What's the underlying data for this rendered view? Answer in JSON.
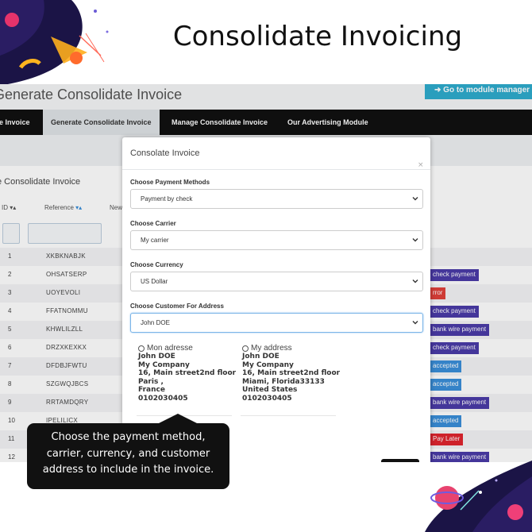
{
  "promo": {
    "title": "Consolidate Invoicing",
    "tooltip": "Choose the payment method, carrier, currency, and customer address to include in the invoice."
  },
  "app": {
    "page_title": "Generate Consolidate Invoice",
    "module_button": "Go to module manager",
    "nav_tabs": [
      {
        "label": "Create Invoice",
        "active": false
      },
      {
        "label": "Generate Consolidate Invoice",
        "active": true
      },
      {
        "label": "Manage Consolidate Invoice",
        "active": false
      },
      {
        "label": "Our Advertising Module",
        "active": false
      }
    ],
    "nav_partial_label": "te Invoice",
    "panel_title": "Generate Consolidate Invoice",
    "panel_partial_title": "e Consolidate Invoice",
    "columns": {
      "id": "ID",
      "reference": "Reference",
      "partial_new": "New"
    },
    "rows": [
      {
        "id": "1",
        "reference": "XKBKNABJK",
        "status": "",
        "status_color": ""
      },
      {
        "id": "2",
        "reference": "OHSATSERP",
        "status": "check payment",
        "status_color": "#4a3ba8"
      },
      {
        "id": "3",
        "reference": "UOYEVOLI",
        "status": "rror",
        "status_color": "#e0403a"
      },
      {
        "id": "4",
        "reference": "FFATNOMMU",
        "status": "check payment",
        "status_color": "#4a3ba8"
      },
      {
        "id": "5",
        "reference": "KHWLILZLL",
        "status": "bank wire payment",
        "status_color": "#4a3ba8"
      },
      {
        "id": "6",
        "reference": "DRZXKEXKX",
        "status": "check payment",
        "status_color": "#4a3ba8"
      },
      {
        "id": "7",
        "reference": "DFDBJFWTU",
        "status": "accepted",
        "status_color": "#3a8fd9"
      },
      {
        "id": "8",
        "reference": "SZGWQJBCS",
        "status": "accepted",
        "status_color": "#3a8fd9"
      },
      {
        "id": "9",
        "reference": "RRTAMDQRY",
        "status": "bank wire payment",
        "status_color": "#4a3ba8"
      },
      {
        "id": "10",
        "reference": "IPELILICX",
        "status": "accepted",
        "status_color": "#3a8fd9"
      },
      {
        "id": "11",
        "reference": "",
        "status": "Pay Later",
        "status_color": "#e0242e"
      },
      {
        "id": "12",
        "reference": "",
        "status": "bank wire payment",
        "status_color": "#4a3ba8"
      }
    ]
  },
  "modal": {
    "title": "Consolate Invoice",
    "close": "×",
    "payment_label": "Choose Payment Methods",
    "payment_value": "Payment by check",
    "carrier_label": "Choose Carrier",
    "carrier_value": "My carrier",
    "currency_label": "Choose Currency",
    "currency_value": "US Dollar",
    "customer_label": "Choose Customer For Address",
    "customer_value": "John DOE",
    "addresses": [
      {
        "name": "Mon adresse",
        "lines": [
          "John DOE",
          "My Company",
          "16, Main street2nd floor",
          "Paris ,",
          "France",
          "0102030405"
        ]
      },
      {
        "name": "My address",
        "lines": [
          "John DOE",
          "My Company",
          "16, Main street2nd floor",
          "Miami, Florida33133",
          "United States",
          "0102030405"
        ]
      }
    ]
  }
}
